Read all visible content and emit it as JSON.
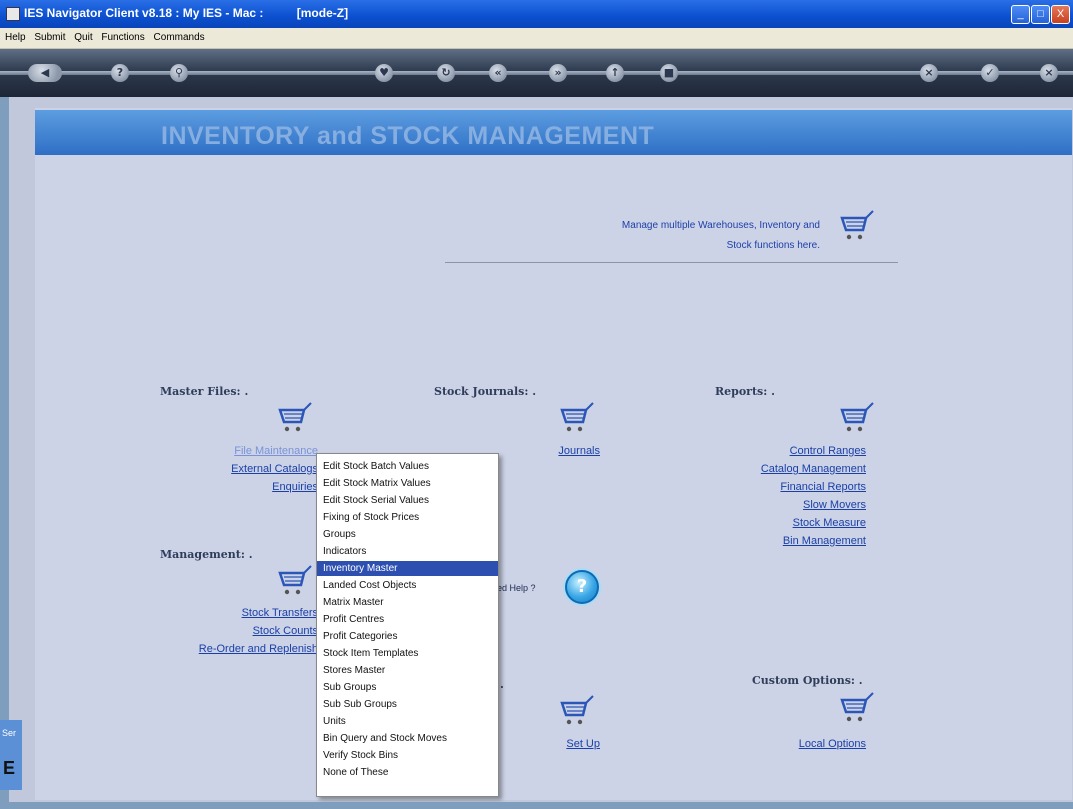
{
  "window": {
    "title": "IES Navigator Client v8.18 : My IES - Mac :",
    "mode": "[mode-Z]",
    "controls": [
      "_",
      "□",
      "X"
    ]
  },
  "menubar": [
    "Help",
    "Submit",
    "Quit",
    "Functions",
    "Commands"
  ],
  "toolbar": {
    "icons": [
      "back-icon",
      "help-icon",
      "search-icon",
      "favorite-icon",
      "refresh-icon",
      "previous-icon",
      "next-icon",
      "up-icon",
      "home-icon",
      "cancel-icon",
      "ok-icon",
      "close-icon"
    ]
  },
  "banner": {
    "title": "INVENTORY and STOCK MANAGEMENT"
  },
  "description": {
    "line1": "Manage multiple Warehouses, Inventory and",
    "line2": "Stock functions here."
  },
  "sections": {
    "master_files": {
      "heading": "Master Files: .",
      "links": [
        "File Maintenance",
        "External Catalogs",
        "Enquiries"
      ]
    },
    "stock_journals": {
      "heading": "Stock Journals: .",
      "links": [
        "Journals"
      ]
    },
    "reports": {
      "heading": "Reports: .",
      "links": [
        "Control Ranges",
        "Catalog Management",
        "Financial Reports",
        "Slow Movers",
        "Stock Measure",
        "Bin Management"
      ]
    },
    "management": {
      "heading": "Management: .",
      "links": [
        "Stock Transfers",
        "Stock Counts",
        "Re-Order and Replenish"
      ]
    },
    "setup": {
      "heading": ".",
      "links": [
        "Set Up"
      ]
    },
    "custom_options": {
      "heading": "Custom Options: .",
      "links": [
        "Local Options"
      ]
    }
  },
  "help": {
    "question": "eed Help ?",
    "button": "?"
  },
  "side_panel": {
    "label": "Ser",
    "letter": "E"
  },
  "dropdown": {
    "items": [
      "Edit Stock Batch Values",
      "Edit Stock Matrix Values",
      "Edit Stock Serial Values",
      "Fixing of Stock Prices",
      "Groups",
      "Indicators",
      "Inventory Master",
      "Landed Cost Objects",
      "Matrix Master",
      "Profit Centres",
      "Profit Categories",
      "Stock Item Templates",
      "Stores Master",
      "Sub Groups",
      "Sub Sub Groups",
      "Units",
      "Bin Query and Stock Moves",
      "Verify Stock Bins",
      "None of These"
    ],
    "selected": "Inventory Master"
  },
  "colors": {
    "banner": "#2e6fc6",
    "link": "#1a3fa8",
    "selection": "#2c4fb0",
    "titlebar": "#0b4fd0"
  }
}
